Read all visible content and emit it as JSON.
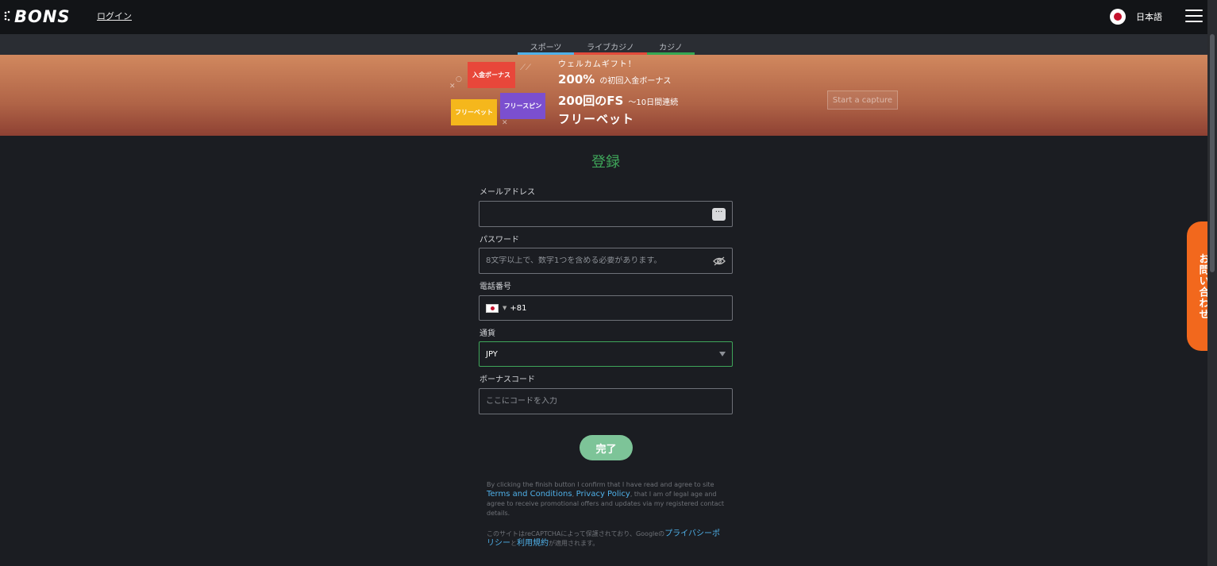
{
  "header": {
    "logo_text": "BONS",
    "login_label": "ログイン",
    "language_label": "日本語"
  },
  "nav": {
    "tabs": [
      {
        "label": "スポーツ"
      },
      {
        "label": "ライブカジノ"
      },
      {
        "label": "カジノ"
      }
    ]
  },
  "banner": {
    "badges": {
      "deposit": "入金ボーナス",
      "freebet": "フリーベット",
      "spins": "フリースピン"
    },
    "gift_title": "ウェルカムギフト！",
    "line1_big": "200%",
    "line1_small": "の初回入金ボーナス",
    "line2_big": "200回のFS",
    "line2_small": "〜10日間連続",
    "line3": "フリーベット",
    "capture_label": "Start a capture"
  },
  "form": {
    "title": "登録",
    "email_label": "メールアドレス",
    "email_value": "",
    "password_label": "パスワード",
    "password_placeholder": "8文字以上で、数字1つを含める必要があります。",
    "phone_label": "電話番号",
    "phone_value": "+81",
    "currency_label": "通貨",
    "currency_value": "JPY",
    "bonus_label": "ボーナスコード",
    "bonus_placeholder": "ここにコードを入力",
    "submit_label": "完了"
  },
  "legal": {
    "p1_a": "By clicking the finish button I confirm that I have read and agree to site",
    "terms_link": "Terms and Conditions",
    "p1_sep": ",",
    "privacy_link": "Privacy Policy",
    "p1_b": ", that I am of legal age and agree to receive promotional offers and updates via my registered contact details.",
    "p2_a": "このサイトはreCAPTCHAによって保護されており、Googleの",
    "google_privacy_link": "プライバシーポリシー",
    "p2_and": "と",
    "google_terms_link": "利用規約",
    "p2_b": "が適用されます。"
  },
  "contact_tab_label": "お問い合わせ",
  "colors": {
    "accent_green": "#3fa65a",
    "sports_blue": "#4fb0e8",
    "live_red": "#e14a3b",
    "contact_orange": "#f2681d"
  }
}
